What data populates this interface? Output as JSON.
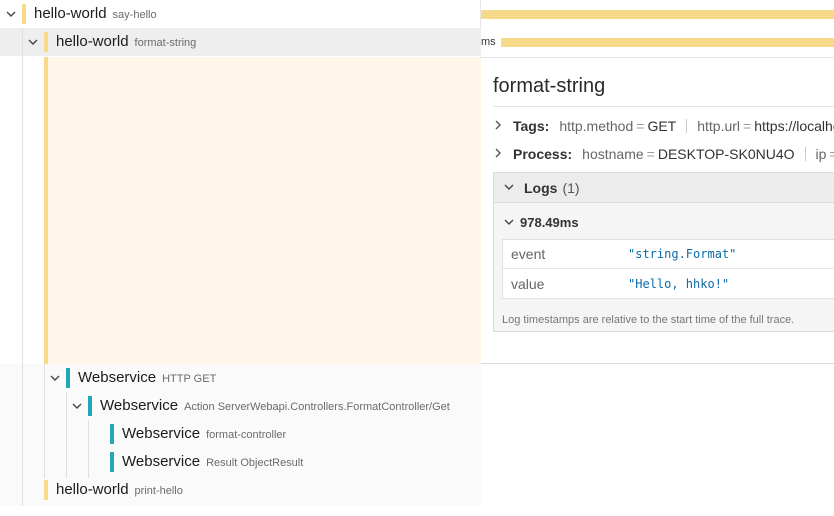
{
  "spans": [
    {
      "service": "hello-world",
      "operation": "say-hello",
      "color": "#f9d98a"
    },
    {
      "service": "hello-world",
      "operation": "format-string",
      "color": "#f9d98a"
    },
    {
      "service": "Webservice",
      "operation": "HTTP GET",
      "color": "#1fa8b6"
    },
    {
      "service": "Webservice",
      "operation": "Action ServerWebapi.Controllers.FormatController/Get",
      "color": "#1fa8b6"
    },
    {
      "service": "Webservice",
      "operation": "format-controller",
      "color": "#1fa8b6"
    },
    {
      "service": "Webservice",
      "operation": "Result ObjectResult",
      "color": "#1fa8b6"
    },
    {
      "service": "hello-world",
      "operation": "print-hello",
      "color": "#f9d98a"
    }
  ],
  "timeline": {
    "partial_duration_label": "ms"
  },
  "detail": {
    "title": "format-string",
    "tags": {
      "label": "Tags:",
      "items": [
        {
          "key": "http.method",
          "value": "GET"
        },
        {
          "key": "http.url",
          "value": "https://localho"
        }
      ]
    },
    "process": {
      "label": "Process:",
      "items": [
        {
          "key": "hostname",
          "value": "DESKTOP-SK0NU4O"
        },
        {
          "key": "ip",
          "value": ""
        }
      ]
    },
    "logs": {
      "label": "Logs",
      "count": "(1)",
      "entry_time": "978.49ms",
      "fields": [
        {
          "key": "event",
          "value": "\"string.Format\""
        },
        {
          "key": "value",
          "value": "\"Hello, hhko!\""
        }
      ],
      "note": "Log timestamps are relative to the start time of the full trace."
    }
  },
  "colors": {
    "accent_yellow": "#f9d98a",
    "accent_teal": "#1fa8b6",
    "selected_detail_bg": "#fff5e8"
  }
}
